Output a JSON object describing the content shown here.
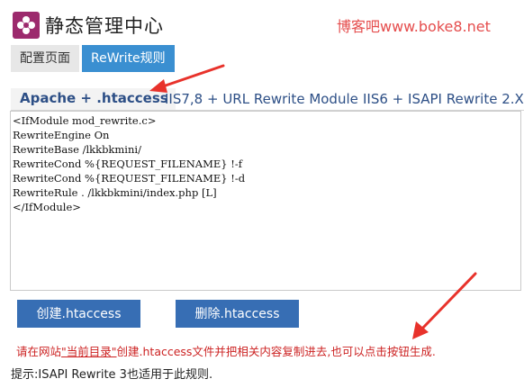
{
  "header": {
    "title": "静态管理中心",
    "watermark": "博客吧www.boke8.net",
    "logo_color": "#9c2a6d"
  },
  "nav": {
    "config_label": "配置页面",
    "rewrite_label": "ReWrite规则"
  },
  "tabs": [
    {
      "label": "Apache + .htaccess",
      "active": true
    },
    {
      "label": "IIS7,8 + URL Rewrite Module",
      "active": false
    },
    {
      "label": "IIS6 + ISAPI Rewrite 2.X",
      "active": false
    }
  ],
  "code": "<IfModule mod_rewrite.c>\nRewriteEngine On\nRewriteBase /lkkbkmini/\nRewriteCond %{REQUEST_FILENAME} !-f\nRewriteCond %{REQUEST_FILENAME} !-d\nRewriteRule . /lkkbkmini/index.php [L]\n</IfModule>",
  "actions": {
    "create_label": "创建.htaccess",
    "delete_label": "删除.htaccess"
  },
  "notice": {
    "prefix": "请在网站",
    "highlight": "\"当前目录\"",
    "suffix": "创建.htaccess文件并把相关内容复制进去,也可以点击按钮生成."
  },
  "tip": "提示:ISAPI Rewrite 3也适用于此规则.",
  "colors": {
    "accent_blue": "#3a8fd1",
    "button_blue": "#376eb4",
    "warning_red": "#cc2222",
    "arrow_red": "#e8322b"
  }
}
